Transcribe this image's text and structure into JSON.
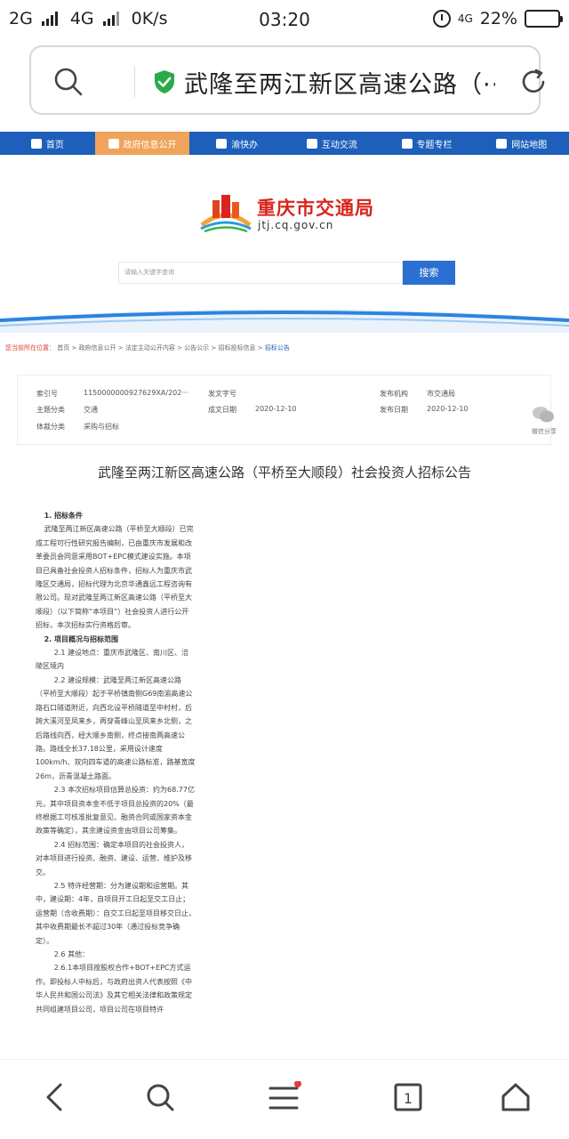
{
  "status_bar": {
    "net1": "2G",
    "net2": "4G",
    "speed": "0K/s",
    "time": "03:20",
    "net3": "4G",
    "battery": "22%",
    "battery_level": 0.22
  },
  "address_bar": {
    "title": "武隆至两江新区高速公路（···"
  },
  "nav": {
    "items": [
      {
        "label": "首页"
      },
      {
        "label": "政府信息公开"
      },
      {
        "label": "渝快办"
      },
      {
        "label": "互动交流"
      },
      {
        "label": "专题专栏"
      },
      {
        "label": "网站地图"
      }
    ]
  },
  "header": {
    "brand": "重庆市交通局",
    "domain": "jtj.cq.gov.cn",
    "search_placeholder": "请输入关键字查询",
    "search_button": "搜索"
  },
  "breadcrumb": {
    "location": "您当前所在位置：",
    "path": "首页 > 政府信息公开 > 法定主动公开内容 > 公告公示 > 招标投标信息 >",
    "current": "招标公告"
  },
  "meta": {
    "index_label": "索引号",
    "index_value": "11500000009276​29XA/202···",
    "doc_no_label": "发文字号",
    "publisher_label": "发布机构",
    "publisher_value": "市交通局",
    "subject_label": "主题分类",
    "subject_value": "交通",
    "created_label": "成文日期",
    "created_value": "2020-12-10",
    "published_label": "发布日期",
    "published_value": "2020-12-10",
    "genre_label": "体裁分类",
    "genre_value": "采购与招标"
  },
  "side": {
    "wechat_label": "微信分享"
  },
  "article": {
    "title": "武隆至两江新区高速公路（平桥至大顺段）社会投资人招标公告",
    "h1": "1. 招标条件",
    "p1": "武隆至两江新区高速公路（平桥至大顺段）已完成工程可行性研究报告编制，已由重庆市发展和改革委员会同意采用BOT+EPC模式建设实施。本项目已具备社会投资人招标条件，招标人为重庆市武隆区交通局，招标代理为北京华通鑫远工程咨询有限公司。现对武隆至两江新区高速公路（平桥至大顺段）（以下简称“本项目”）社会投资人进行公开招标，本次招标实行资格后审。",
    "h2": "2. 项目概况与招标范围",
    "p21": "2.1 建设地点：重庆市武隆区、南川区、涪陵区境内",
    "p22": "2.2 建设规模：武隆至两江新区高速公路（平桥至大顺段）起于平桥镇南侧G69南渝高速公路石口隧道附近，向西北设平桥隧道至中村村，后跨大溪河至凤来乡，再穿青峰山至凤来乡北侧，之后路线向西，经大顺乡南侧，终点接南两高速公路。路线全长37.18公里，采用设计速度100km/h、双向四车道的高速公路标准，路基宽度26m，沥青混凝土路面。",
    "p23": "2.3 本次招标项目估算总投资：约为68.77亿元，其中项目资本金不低于项目总投资的20%（最终根据工可核准批复意见、融资合同或国家资本金政策等确定），其余建设资金由项目公司筹集。",
    "p24": "2.4 招标范围：确定本项目的社会投资人，对本项目进行投资、融资、建设、运营、维护及移交。",
    "p25": "2.5 特许经营期：分为建设期和运营期。其中，建设期：4年，自项目开工日起至交工日止；运营期（含收费期）：自交工日起至项目移交日止，其中收费期最长不超过30年（通过投标竞争确定）。",
    "p26": "2.6 其他：",
    "p261": "2.6.1本项目按股权合作+BOT+EPC方式运作。即投标人中标后，与政府出资人代表按照《中华人民共和国公司法》及其它相关法律和政策规定共同组建项目公司，项目公司在项目特许"
  }
}
